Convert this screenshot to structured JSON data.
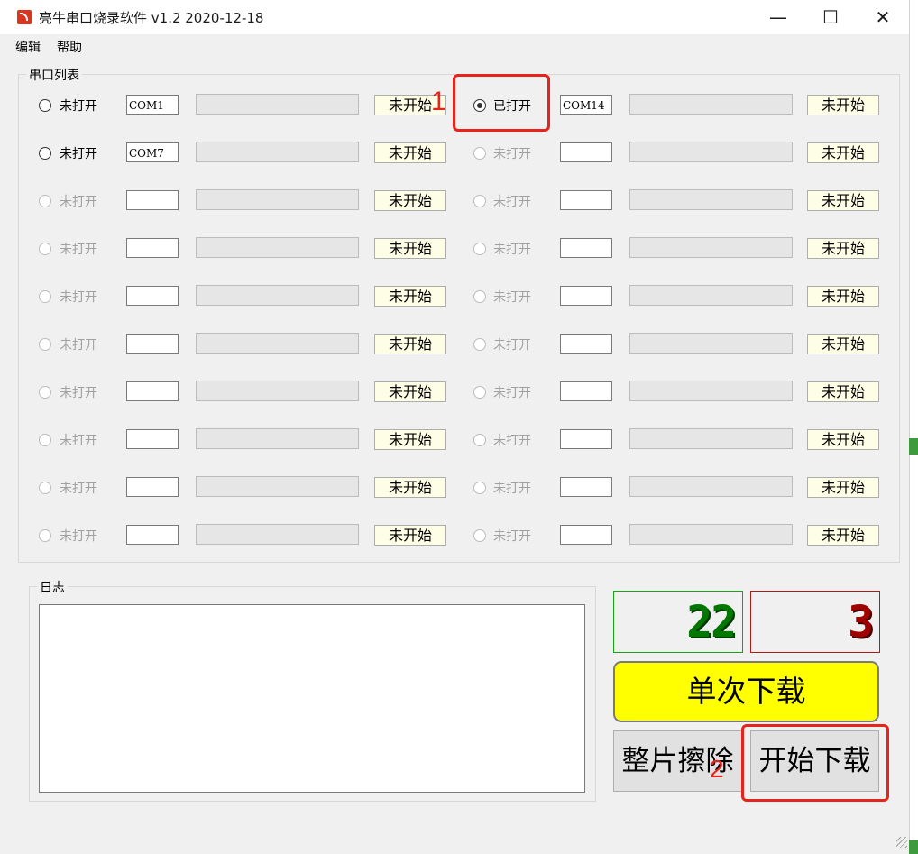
{
  "window": {
    "title": "亮牛串口烧录软件 v1.2 2020-12-18",
    "app_icon": "app-logo-icon",
    "controls": {
      "minimize": "—",
      "maximize": "☐",
      "close": "✕"
    }
  },
  "menu": {
    "edit": "编辑",
    "help": "帮助"
  },
  "port_group": {
    "label": "串口列表",
    "left_rows": [
      {
        "state": "未打开",
        "port": "COM1",
        "status": "未开始",
        "enabled": true,
        "checked": false,
        "progress": 0
      },
      {
        "state": "未打开",
        "port": "COM7",
        "status": "未开始",
        "enabled": true,
        "checked": false,
        "progress": 0
      },
      {
        "state": "未打开",
        "port": "",
        "status": "未开始",
        "enabled": false,
        "checked": false,
        "progress": 0
      },
      {
        "state": "未打开",
        "port": "",
        "status": "未开始",
        "enabled": false,
        "checked": false,
        "progress": 0
      },
      {
        "state": "未打开",
        "port": "",
        "status": "未开始",
        "enabled": false,
        "checked": false,
        "progress": 0
      },
      {
        "state": "未打开",
        "port": "",
        "status": "未开始",
        "enabled": false,
        "checked": false,
        "progress": 0
      },
      {
        "state": "未打开",
        "port": "",
        "status": "未开始",
        "enabled": false,
        "checked": false,
        "progress": 0
      },
      {
        "state": "未打开",
        "port": "",
        "status": "未开始",
        "enabled": false,
        "checked": false,
        "progress": 0
      },
      {
        "state": "未打开",
        "port": "",
        "status": "未开始",
        "enabled": false,
        "checked": false,
        "progress": 0
      },
      {
        "state": "未打开",
        "port": "",
        "status": "未开始",
        "enabled": false,
        "checked": false,
        "progress": 0
      }
    ],
    "right_rows": [
      {
        "state": "已打开",
        "port": "COM14",
        "status": "未开始",
        "enabled": true,
        "checked": true,
        "progress": 0
      },
      {
        "state": "未打开",
        "port": "",
        "status": "未开始",
        "enabled": false,
        "checked": false,
        "progress": 0
      },
      {
        "state": "未打开",
        "port": "",
        "status": "未开始",
        "enabled": false,
        "checked": false,
        "progress": 0
      },
      {
        "state": "未打开",
        "port": "",
        "status": "未开始",
        "enabled": false,
        "checked": false,
        "progress": 0
      },
      {
        "state": "未打开",
        "port": "",
        "status": "未开始",
        "enabled": false,
        "checked": false,
        "progress": 0
      },
      {
        "state": "未打开",
        "port": "",
        "status": "未开始",
        "enabled": false,
        "checked": false,
        "progress": 0
      },
      {
        "state": "未打开",
        "port": "",
        "status": "未开始",
        "enabled": false,
        "checked": false,
        "progress": 0
      },
      {
        "state": "未打开",
        "port": "",
        "status": "未开始",
        "enabled": false,
        "checked": false,
        "progress": 0
      },
      {
        "state": "未打开",
        "port": "",
        "status": "未开始",
        "enabled": false,
        "checked": false,
        "progress": 0
      },
      {
        "state": "未打开",
        "port": "",
        "status": "未开始",
        "enabled": false,
        "checked": false,
        "progress": 0
      }
    ]
  },
  "log_group": {
    "label": "日志",
    "content": ""
  },
  "counters": {
    "success": "22",
    "fail": "3",
    "success_color": "#007800",
    "fail_color": "#a00000"
  },
  "buttons": {
    "single_download": "单次下载",
    "erase_chip": "整片擦除",
    "start_download": "开始下载",
    "single_download_color": "#ffff00"
  },
  "annotations": {
    "label_1": "1",
    "label_2": "2",
    "color": "#e8231c"
  }
}
